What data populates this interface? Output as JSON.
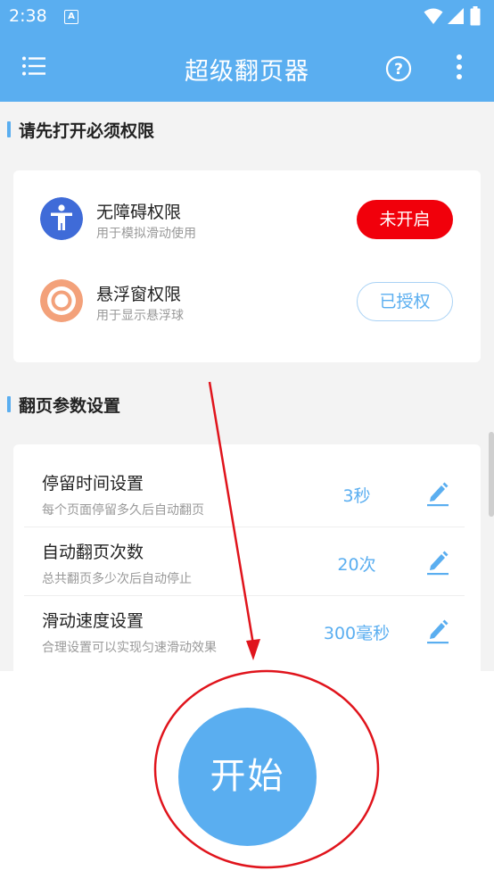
{
  "status_bar": {
    "time": "2:38",
    "notification_glyph": "A"
  },
  "app_bar": {
    "title": "超级翻页器",
    "help_glyph": "?"
  },
  "permissions": {
    "title": "请先打开必须权限",
    "items": [
      {
        "name": "无障碍权限",
        "desc": "用于模拟滑动使用",
        "button": "未开启",
        "icon": "accessibility-icon",
        "color": "#3f6bd8"
      },
      {
        "name": "悬浮窗权限",
        "desc": "用于显示悬浮球",
        "button": "已授权",
        "icon": "floating-ball-icon",
        "color": "#f3a17a"
      }
    ]
  },
  "params": {
    "title": "翻页参数设置",
    "items": [
      {
        "name": "停留时间设置",
        "desc": "每个页面停留多久后自动翻页",
        "value": "3秒"
      },
      {
        "name": "自动翻页次数",
        "desc": "总共翻页多少次后自动停止",
        "value": "20次"
      },
      {
        "name": "滑动速度设置",
        "desc": "合理设置可以实现匀速滑动效果",
        "value": "300毫秒"
      }
    ]
  },
  "start_button": {
    "label": "开始"
  },
  "colors": {
    "primary": "#5aaef0",
    "danger": "#f1000b",
    "annotation": "#e0141c"
  }
}
